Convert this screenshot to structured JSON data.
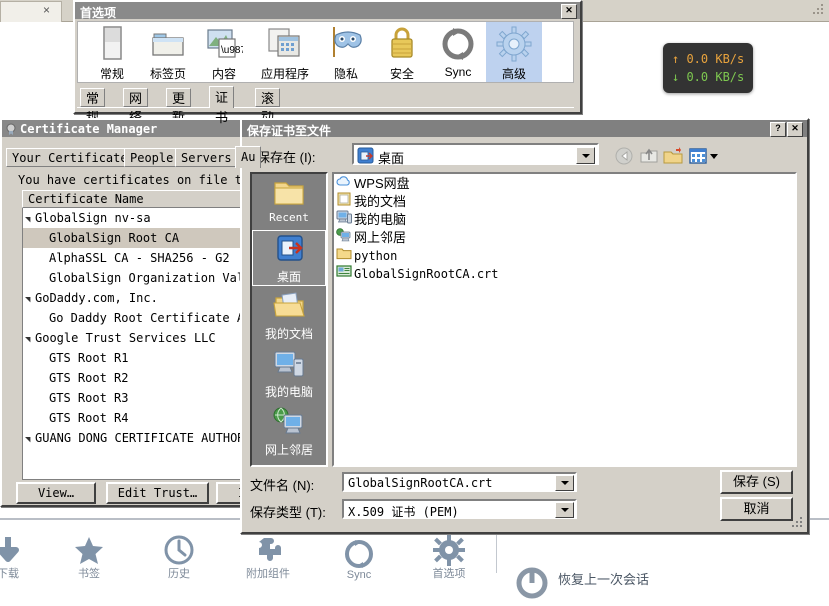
{
  "background": {
    "tab_close_label": "×",
    "home_items": [
      {
        "label": "下载",
        "icon": "download-icon"
      },
      {
        "label": "书签",
        "icon": "star-icon"
      },
      {
        "label": "历史",
        "icon": "clock-icon"
      },
      {
        "label": "附加组件",
        "icon": "puzzle-icon"
      },
      {
        "label": "Sync",
        "icon": "sync-icon"
      },
      {
        "label": "首选项",
        "icon": "gear-icon"
      }
    ],
    "restore_label": "恢复上一次会话"
  },
  "netspeed": {
    "upload": "↑ 0.0 KB/s",
    "download": "↓ 0.0 KB/s",
    "upload_color": "#e8a33d",
    "download_color": "#7ec850",
    "background_color": "#333333"
  },
  "preferences": {
    "title": "首选项",
    "close_label": "✕",
    "toolbar_items": [
      {
        "label": "常规",
        "icon": "general-panel-icon",
        "selected": false
      },
      {
        "label": "标签页",
        "icon": "tabs-folder-icon",
        "selected": false
      },
      {
        "label": "内容",
        "icon": "content-page-icon",
        "selected": false
      },
      {
        "label": "应用程序",
        "icon": "applications-icon",
        "selected": false
      },
      {
        "label": "隐私",
        "icon": "privacy-mask-icon",
        "selected": false
      },
      {
        "label": "安全",
        "icon": "security-lock-icon",
        "selected": false
      },
      {
        "label": "Sync",
        "icon": "sync-icon",
        "selected": false
      },
      {
        "label": "高级",
        "icon": "advanced-gear-icon",
        "selected": true
      }
    ],
    "tabs": [
      {
        "label": "常规",
        "selected": false
      },
      {
        "label": "网络",
        "selected": false
      },
      {
        "label": "更新",
        "selected": false
      },
      {
        "label": "证书",
        "selected": true
      },
      {
        "label": "滚动",
        "selected": false
      }
    ]
  },
  "certificate_manager": {
    "title": "Certificate Manager",
    "tabs": [
      {
        "label": "Your Certificates",
        "selected": false
      },
      {
        "label": "People",
        "selected": false
      },
      {
        "label": "Servers",
        "selected": false
      },
      {
        "label": "Au",
        "selected": true
      }
    ],
    "description": "You have certificates on file that id",
    "column_header": "Certificate Name",
    "rows": [
      {
        "label": "GlobalSign nv-sa",
        "level": 0,
        "expanded": true,
        "selected": false
      },
      {
        "label": "GlobalSign Root CA",
        "level": 1,
        "expanded": false,
        "selected": true
      },
      {
        "label": "AlphaSSL CA - SHA256 - G2",
        "level": 1,
        "expanded": false,
        "selected": false
      },
      {
        "label": "GlobalSign Organization Validation",
        "level": 1,
        "expanded": false,
        "selected": false
      },
      {
        "label": "GoDaddy.com, Inc.",
        "level": 0,
        "expanded": true,
        "selected": false
      },
      {
        "label": "Go Daddy Root Certificate Authorit",
        "level": 1,
        "expanded": false,
        "selected": false
      },
      {
        "label": "Google Trust Services LLC",
        "level": 0,
        "expanded": true,
        "selected": false
      },
      {
        "label": "GTS Root R1",
        "level": 1,
        "expanded": false,
        "selected": false
      },
      {
        "label": "GTS Root R2",
        "level": 1,
        "expanded": false,
        "selected": false
      },
      {
        "label": "GTS Root R3",
        "level": 1,
        "expanded": false,
        "selected": false
      },
      {
        "label": "GTS Root R4",
        "level": 1,
        "expanded": false,
        "selected": false
      },
      {
        "label": "GUANG DONG CERTIFICATE AUTHORITY CO.",
        "level": 0,
        "expanded": true,
        "selected": false
      }
    ],
    "buttons": [
      {
        "label": "View…"
      },
      {
        "label": "Edit Trust…"
      },
      {
        "label": "Impor"
      }
    ]
  },
  "save_dialog": {
    "title": "保存证书至文件",
    "help_label": "?",
    "close_label": "✕",
    "look_in_label": "保存在 (I):",
    "look_in_value": "桌面",
    "toolbar_icons": [
      "back-icon",
      "up-folder-icon",
      "new-folder-icon",
      "views-icon"
    ],
    "places": [
      {
        "label": "Recent",
        "icon": "recent-folder-icon",
        "selected": false,
        "mono": true
      },
      {
        "label": "桌面",
        "icon": "desktop-icon",
        "selected": true,
        "mono": false
      },
      {
        "label": "我的文档",
        "icon": "my-documents-icon",
        "selected": false,
        "mono": false
      },
      {
        "label": "我的电脑",
        "icon": "my-computer-icon",
        "selected": false,
        "mono": false
      },
      {
        "label": "网上邻居",
        "icon": "network-places-icon",
        "selected": false,
        "mono": false
      }
    ],
    "files": [
      {
        "label": "WPS网盘",
        "icon": "cloud-icon",
        "mono": false
      },
      {
        "label": "我的文档",
        "icon": "my-documents-icon",
        "mono": false
      },
      {
        "label": "我的电脑",
        "icon": "my-computer-icon",
        "mono": false
      },
      {
        "label": "网上邻居",
        "icon": "network-places-icon",
        "mono": false
      },
      {
        "label": "python",
        "icon": "folder-icon",
        "mono": true
      },
      {
        "label": "GlobalSignRootCA.crt",
        "icon": "certificate-file-icon",
        "mono": true
      }
    ],
    "file_name_label": "文件名 (N):",
    "file_name_value": "GlobalSignRootCA.crt",
    "file_type_label": "保存类型 (T):",
    "file_type_value": "X.509 证书 (PEM)",
    "save_button": "保存 (S)",
    "cancel_button": "取消"
  }
}
